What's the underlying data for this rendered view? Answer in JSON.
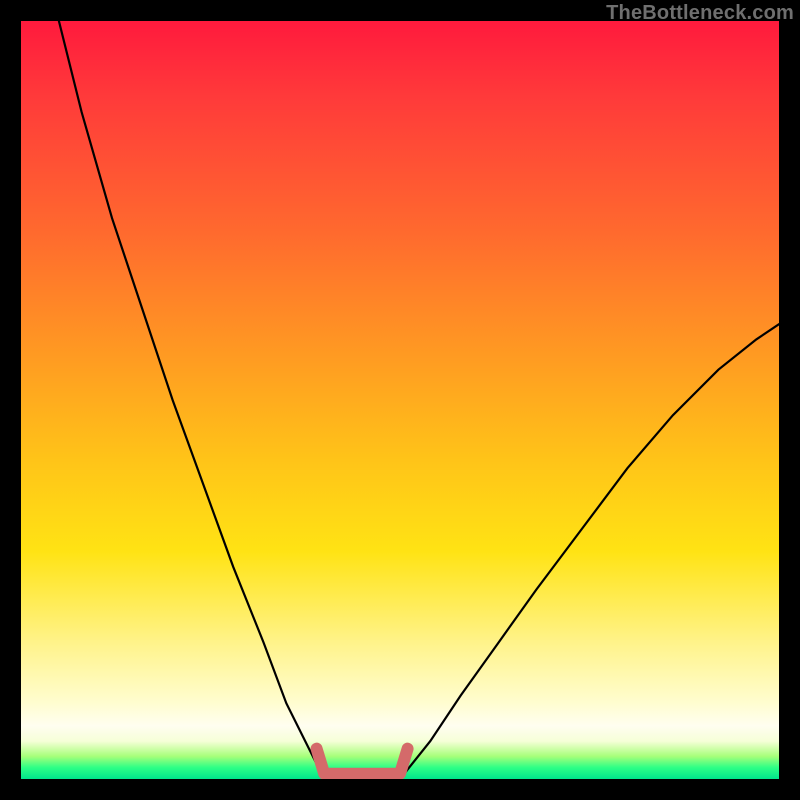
{
  "watermark": "TheBottleneck.com",
  "chart_data": {
    "type": "line",
    "title": "",
    "xlabel": "",
    "ylabel": "",
    "xlim": [
      0,
      100
    ],
    "ylim": [
      0,
      100
    ],
    "grid": false,
    "series": [
      {
        "name": "left-curve",
        "color": "#000000",
        "x": [
          5,
          8,
          12,
          16,
          20,
          24,
          28,
          32,
          35,
          38,
          40
        ],
        "y": [
          100,
          88,
          74,
          62,
          50,
          39,
          28,
          18,
          10,
          4,
          0
        ]
      },
      {
        "name": "right-curve",
        "color": "#000000",
        "x": [
          50,
          54,
          58,
          63,
          68,
          74,
          80,
          86,
          92,
          97,
          100
        ],
        "y": [
          0,
          5,
          11,
          18,
          25,
          33,
          41,
          48,
          54,
          58,
          60
        ]
      },
      {
        "name": "bottom-bracket",
        "color": "#d46a6a",
        "x": [
          39,
          40,
          41,
          49,
          50,
          51
        ],
        "y": [
          4,
          0.7,
          0.7,
          0.7,
          0.7,
          4
        ]
      }
    ]
  }
}
